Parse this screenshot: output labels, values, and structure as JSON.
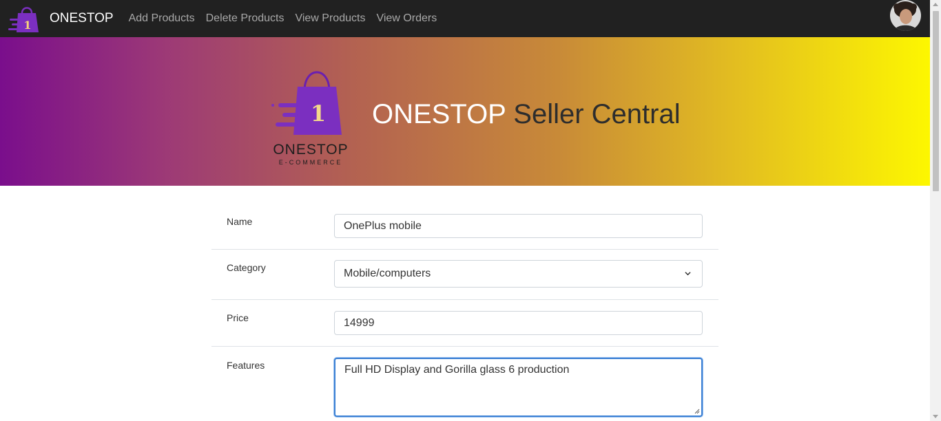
{
  "nav": {
    "brand": "ONESTOP",
    "links": [
      "Add Products",
      "Delete Products",
      "View Products",
      "View Orders"
    ],
    "logo_digit": "1"
  },
  "banner": {
    "title_bold": "ONESTOP",
    "title_rest": "Seller Central",
    "logo_name": "ONESTOP",
    "logo_sub": "E-COMMERCE",
    "logo_digit": "1"
  },
  "form": {
    "name_label": "Name",
    "name_value": "OnePlus mobile",
    "category_label": "Category",
    "category_value": "Mobile/computers",
    "price_label": "Price",
    "price_value": "14999",
    "features_label": "Features",
    "features_value": "Full HD Display and Gorilla glass 6 production"
  },
  "colors": {
    "navbar": "#212121",
    "brand_purple": "#7b2fc0",
    "focus_blue": "#3a7fd4"
  }
}
